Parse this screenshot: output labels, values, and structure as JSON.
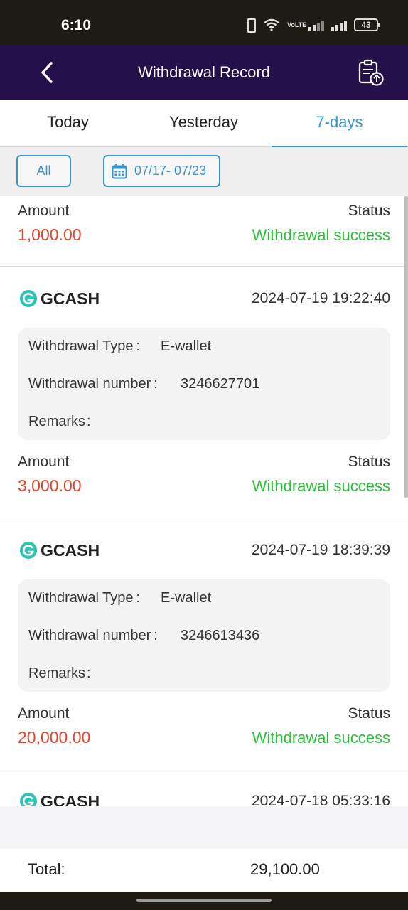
{
  "status_bar": {
    "time": "6:10",
    "volte": "VoLTE",
    "battery": "43"
  },
  "header": {
    "title": "Withdrawal Record",
    "back_icon": "chevron-left-icon",
    "export_icon": "clipboard-upload-icon"
  },
  "tabs": [
    {
      "label": "Today",
      "active": false
    },
    {
      "label": "Yesterday",
      "active": false
    },
    {
      "label": "7-days",
      "active": true
    }
  ],
  "filters": {
    "all_label": "All",
    "date_range": "07/17- 07/23"
  },
  "colors": {
    "header_bg": "#24104a",
    "accent": "#3a93cf",
    "amount": "#e0452c",
    "success": "#2cbf3a",
    "gcash": "#2ec4b6"
  },
  "partial_record": {
    "amount_label": "Amount",
    "status_label": "Status",
    "amount": "1,000.00",
    "status": "Withdrawal success"
  },
  "records": [
    {
      "provider": "GCASH",
      "datetime": "2024-07-19 19:22:40",
      "type_label": "Withdrawal Type",
      "type": "E-wallet",
      "number_label": "Withdrawal number",
      "number": "3246627701",
      "remarks_label": "Remarks",
      "remarks": "",
      "amount_label": "Amount",
      "status_label": "Status",
      "amount": "3,000.00",
      "status": "Withdrawal success"
    },
    {
      "provider": "GCASH",
      "datetime": "2024-07-19 18:39:39",
      "type_label": "Withdrawal Type",
      "type": "E-wallet",
      "number_label": "Withdrawal number",
      "number": "3246613436",
      "remarks_label": "Remarks",
      "remarks": "",
      "amount_label": "Amount",
      "status_label": "Status",
      "amount": "20,000.00",
      "status": "Withdrawal success"
    },
    {
      "provider": "GCASH",
      "datetime": "2024-07-18 05:33:16"
    }
  ],
  "total": {
    "label": "Total:",
    "value": "29,100.00"
  }
}
